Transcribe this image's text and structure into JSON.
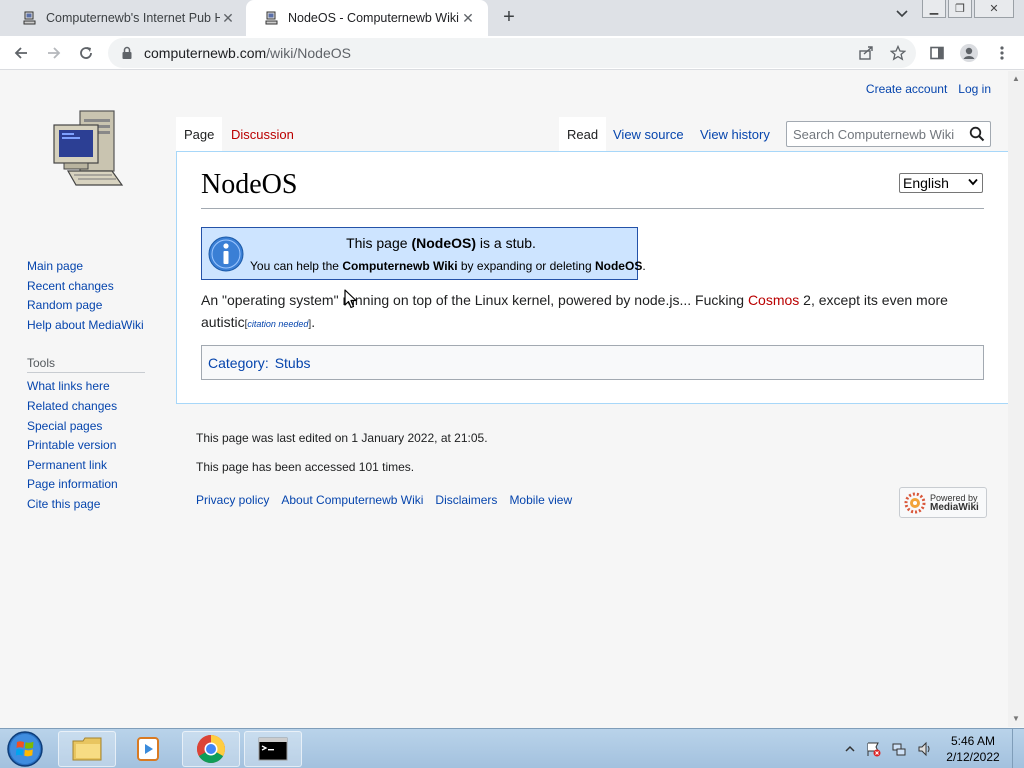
{
  "browser": {
    "tabs": [
      {
        "title": "Computernewb's Internet Pub Hub",
        "close": "✕"
      },
      {
        "title": "NodeOS - Computernewb Wiki",
        "close": "✕"
      }
    ],
    "new_tab": "+",
    "url_host": "computernewb.com",
    "url_path": "/wiki/NodeOS"
  },
  "wiki": {
    "personal": {
      "create_account": "Create account",
      "log_in": "Log in"
    },
    "tabs": {
      "page": "Page",
      "discussion": "Discussion",
      "read": "Read",
      "view_source": "View source",
      "view_history": "View history"
    },
    "search_placeholder": "Search Computernewb Wiki",
    "title": "NodeOS",
    "language": "English",
    "stub": {
      "line1_pre": "This page ",
      "line1_bold": "(NodeOS)",
      "line1_post": " is a stub.",
      "line2_pre": "You can help the ",
      "line2_bold1": "Computernewb Wiki",
      "line2_mid": " by expanding or deleting ",
      "line2_bold2": "NodeOS",
      "line2_post": "."
    },
    "body": {
      "part1": "An \"operating system\" running on top of the Linux kernel, powered by node.js... Fucking ",
      "link": "Cosmos",
      "part2": " 2, except its even more autistic",
      "cite_open": "[",
      "cite": "citation needed",
      "cite_close": "]",
      "end": "."
    },
    "category": {
      "label": "Category",
      "colon": ":",
      "item": "Stubs"
    },
    "sidebar": {
      "nav": [
        "Main page",
        "Recent changes",
        "Random page",
        "Help about MediaWiki"
      ],
      "tools_heading": "Tools",
      "tools": [
        "What links here",
        "Related changes",
        "Special pages",
        "Printable version",
        "Permanent link",
        "Page information",
        "Cite this page"
      ]
    },
    "footer": {
      "edited": "This page was last edited on 1 January 2022, at 21:05.",
      "accessed": "This page has been accessed 101 times.",
      "links": [
        "Privacy policy",
        "About Computernewb Wiki",
        "Disclaimers",
        "Mobile view"
      ],
      "powered_line1": "Powered by",
      "powered_line2": "MediaWiki"
    }
  },
  "taskbar": {
    "time": "5:46 AM",
    "date": "2/12/2022"
  },
  "colors": {
    "link": "#0645ad",
    "redlink": "#ba0000",
    "stub_bg": "#cde4ff",
    "stub_border": "#2452a8"
  }
}
